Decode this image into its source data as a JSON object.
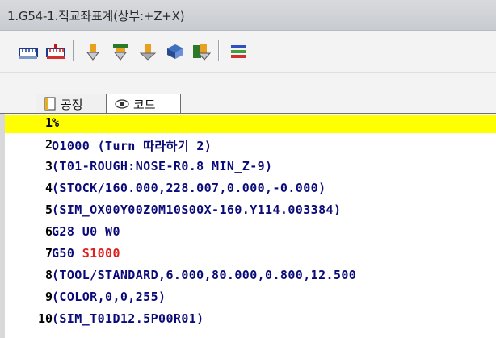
{
  "window": {
    "title": "1.G54-1.직교좌표계(상부:+Z+X)"
  },
  "toolbar": {
    "icons": [
      "ruler-icon",
      "ruler-red-icon",
      "tool-yellow-icon",
      "tool-stack-icon",
      "tool-icon",
      "tool-turret-icon",
      "tool-assembly-icon",
      "color-bars-icon"
    ]
  },
  "tabs": [
    {
      "label": "공정",
      "icon": "document-icon",
      "active": false
    },
    {
      "label": "코드",
      "icon": "eye-icon",
      "active": true
    }
  ],
  "editor": {
    "lines": [
      {
        "num": "1",
        "text": "%"
      },
      {
        "num": "2",
        "text": "O1000 (Turn 따라하기 2)"
      },
      {
        "num": "3",
        "text": "(T01-ROUGH:NOSE-R0.8 MIN_Z-9)"
      },
      {
        "num": "4",
        "text": "(STOCK/160.000,228.007,0.000,-0.000)"
      },
      {
        "num": "5",
        "text": "(SIM_OX00Y00Z0M10S00X-160.Y114.003384)"
      },
      {
        "num": "6",
        "text": "G28 U0 W0"
      },
      {
        "num": "7",
        "text": "G50 ",
        "highlight": "S1000"
      },
      {
        "num": "8",
        "text": "(TOOL/STANDARD,6.000,80.000,0.800,12.500"
      },
      {
        "num": "9",
        "text": "(COLOR,0,0,255)"
      },
      {
        "num": "10",
        "text": "(SIM_T01D12.5P00R01)"
      }
    ],
    "current_line_color": "#ffff00",
    "code_color": "#0a0a78",
    "highlight_color": "#e02020"
  }
}
